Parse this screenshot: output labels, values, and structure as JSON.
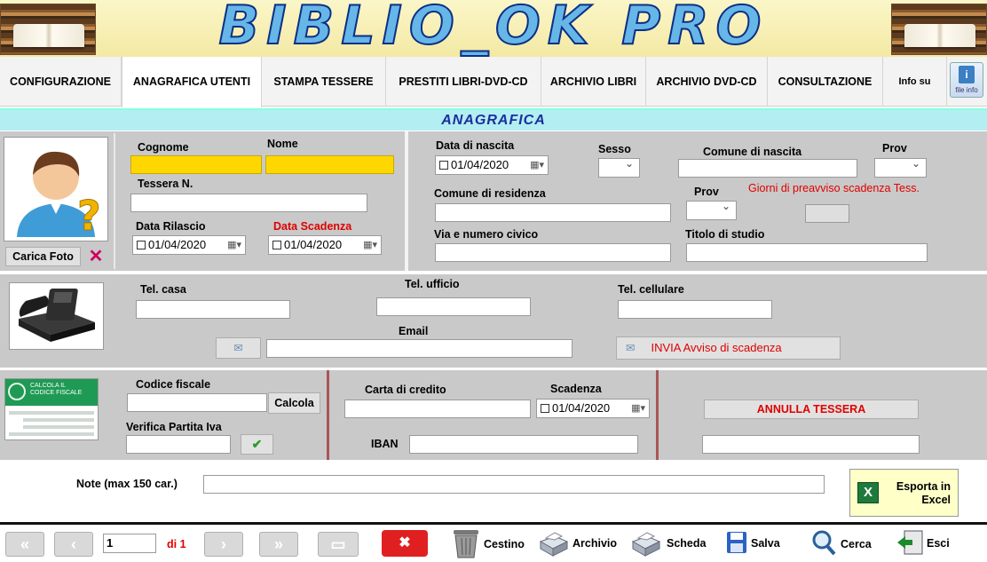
{
  "app": {
    "title": "BIBLIO_OK PRO"
  },
  "tabs": [
    {
      "label": "CONFIGURAZIONE"
    },
    {
      "label": "ANAGRAFICA UTENTI"
    },
    {
      "label": "STAMPA TESSERE"
    },
    {
      "label": "PRESTITI LIBRI-DVD-CD"
    },
    {
      "label": "ARCHIVIO LIBRI"
    },
    {
      "label": "ARCHIVIO DVD-CD"
    },
    {
      "label": "CONSULTAZIONE"
    },
    {
      "label": "Info su"
    }
  ],
  "info_button": {
    "label": "file info",
    "icon": "info-icon"
  },
  "section": {
    "title": "ANAGRAFICA"
  },
  "personal": {
    "cognome_label": "Cognome",
    "nome_label": "Nome",
    "tessera_label": "Tessera N.",
    "data_rilascio_label": "Data Rilascio",
    "data_scadenza_label": "Data Scadenza",
    "data_rilascio_value": "01/04/2020",
    "data_scadenza_value": "01/04/2020",
    "carica_foto_label": "Carica Foto",
    "cognome_value": "",
    "nome_value": "",
    "tessera_value": ""
  },
  "birth": {
    "data_nascita_label": "Data di nascita",
    "data_nascita_value": "01/04/2020",
    "sesso_label": "Sesso",
    "comune_nascita_label": "Comune di nascita",
    "prov_label": "Prov",
    "comune_residenza_label": "Comune di residenza",
    "prov_res_label": "Prov",
    "giorni_preavviso_label": "Giorni di preavviso scadenza Tess.",
    "via_label": "Via e numero civico",
    "titolo_studio_label": "Titolo di studio"
  },
  "contacts": {
    "tel_casa_label": "Tel. casa",
    "tel_ufficio_label": "Tel. ufficio",
    "tel_cellulare_label": "Tel. cellulare",
    "email_label": "Email",
    "invia_label": "INVIA  Avviso di scadenza"
  },
  "fiscal": {
    "codice_fiscale_label": "Codice fiscale",
    "calcola_label": "Calcola",
    "verifica_label": "Verifica Partita Iva",
    "cf_card_title1": "CALCOLA IL",
    "cf_card_title2": "CODICE FISCALE",
    "carta_credito_label": "Carta di credito",
    "scadenza_label": "Scadenza",
    "scadenza_value": "01/04/2020",
    "iban_label": "IBAN",
    "annulla_label": "ANNULLA TESSERA"
  },
  "notes": {
    "note_label": "Note (max 150 car.)",
    "esporta_label1": "Esporta in",
    "esporta_label2": "Excel"
  },
  "footer": {
    "record_value": "1",
    "di_label": "di 1",
    "cestino_label": "Cestino",
    "archivio_label": "Archivio",
    "scheda_label": "Scheda",
    "salva_label": "Salva",
    "cerca_label": "Cerca",
    "esci_label": "Esci"
  },
  "colors": {
    "accent": "#ffd700",
    "section_bg": "#b3eef3",
    "panel_bg": "#c9c9c9",
    "alert": "#e00000"
  }
}
